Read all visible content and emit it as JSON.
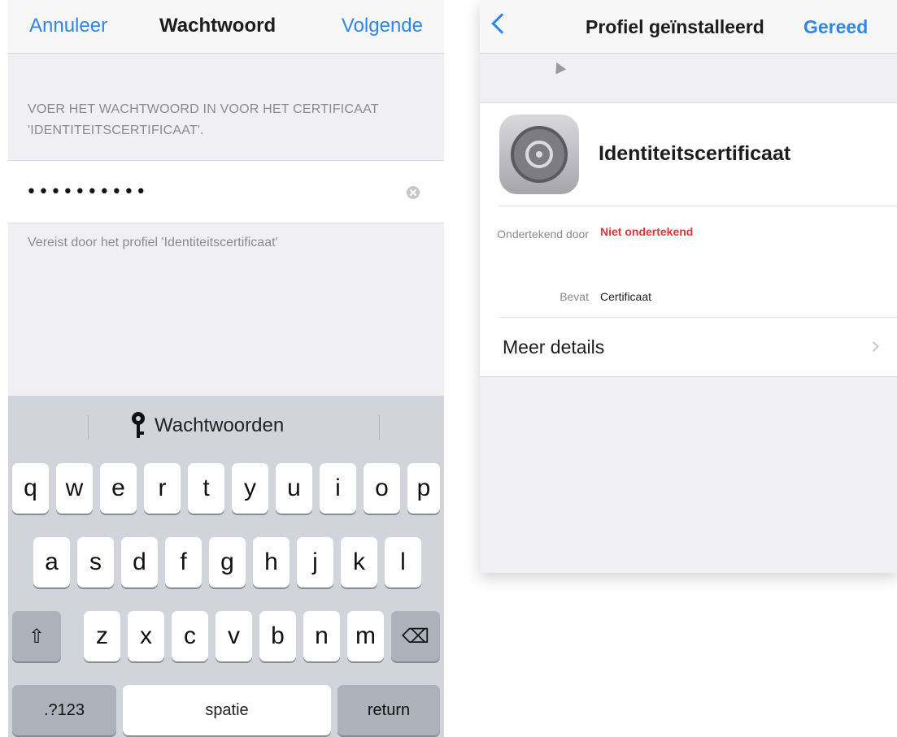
{
  "left": {
    "nav": {
      "cancel": "Annuleer",
      "title": "Wachtwoord",
      "next": "Volgende"
    },
    "section_header": "VOER HET WACHTWOORD IN VOOR HET CERTIFICAAT 'IDENTITEITSCERTIFICAAT'.",
    "password_value": "••••••••••",
    "footer_note": "Vereist door het profiel 'Identiteitscertificaat'",
    "keyboard": {
      "suggestion": "Wachtwoorden",
      "row1": [
        "q",
        "w",
        "e",
        "r",
        "t",
        "y",
        "u",
        "i",
        "o",
        "p"
      ],
      "row2": [
        "a",
        "s",
        "d",
        "f",
        "g",
        "h",
        "j",
        "k",
        "l"
      ],
      "row3": [
        "z",
        "x",
        "c",
        "v",
        "b",
        "n",
        "m"
      ],
      "numbers": ".?123",
      "space": "spatie",
      "return": "return",
      "shift_symbol": "⇧",
      "backspace_symbol": "⌫"
    }
  },
  "right": {
    "nav": {
      "title": "Profiel geïnstalleerd",
      "done": "Gereed"
    },
    "profile_name": "Identiteitscertificaat",
    "signed_by_label": "Ondertekend door",
    "signed_by_value": "Niet ondertekend",
    "contains_label": "Bevat",
    "contains_value": "Certificaat",
    "more_details": "Meer details"
  },
  "colors": {
    "accent": "#2f86e8",
    "warning": "#e4323a",
    "keyboard_bg": "#d1d4da",
    "grouped_bg": "#efeff4"
  },
  "icons": {
    "back": "chevron-left-icon",
    "clear": "clear-circle-icon",
    "key": "key-icon",
    "settings": "settings-gear-icon",
    "disclosure": "chevron-right-icon"
  }
}
